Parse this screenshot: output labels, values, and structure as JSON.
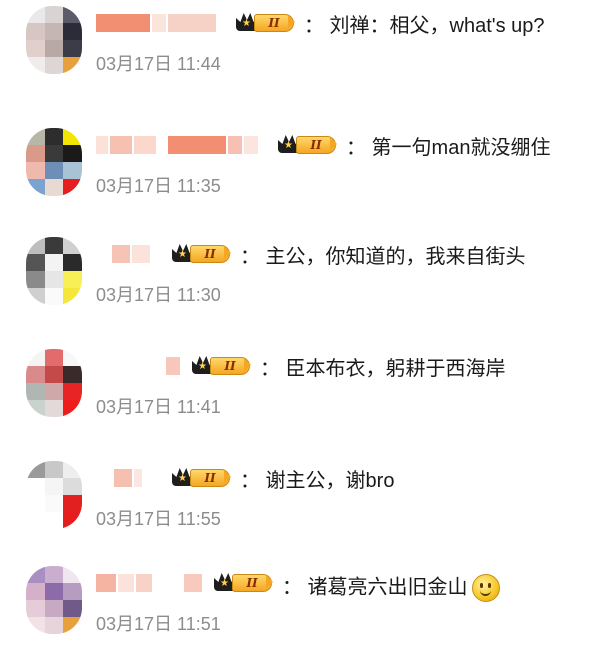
{
  "colors": {
    "timestamp": "#8c8c8c",
    "text": "#1a1a1a",
    "badge_gold": "#f5a623"
  },
  "level_badge_label": "II",
  "comments": [
    {
      "text": "：  刘禅：相父，what's up?",
      "time": "03月17日 11:44"
    },
    {
      "text": "：  第一句man就没绷住",
      "time": "03月17日 11:35"
    },
    {
      "text": "：  主公，你知道的，我来自街头",
      "time": "03月17日 11:30"
    },
    {
      "text": "：  臣本布衣，躬耕于西海岸",
      "time": "03月17日 11:41"
    },
    {
      "text": "：  谢主公，谢bro",
      "time": "03月17日 11:55"
    },
    {
      "text": "：  诸葛亮六出旧金山",
      "time": "03月17日 11:51"
    }
  ]
}
